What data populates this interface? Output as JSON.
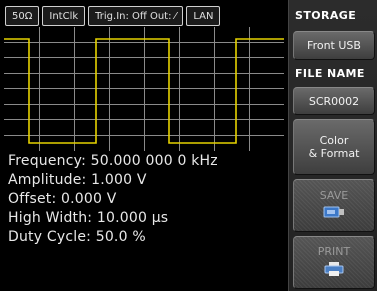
{
  "status_bar": [
    "50Ω",
    "IntClk",
    "Trig.In: Off Out: ⁄",
    "LAN"
  ],
  "readouts": {
    "frequency": "Frequency: 50.000 000 0 kHz",
    "amplitude": "Amplitude: 1.000 V",
    "offset": "Offset: 0.000 V",
    "high_width": "High Width: 10.000 µs",
    "duty_cycle": "Duty Cycle: 50.0 %"
  },
  "sidebar": {
    "storage_header": "STORAGE",
    "storage_button": "Front USB",
    "filename_header": "FILE NAME",
    "filename_button": "SCR0002",
    "color_format_line1": "Color",
    "color_format_line2": "& Format",
    "save_label": "SAVE",
    "print_label": "PRINT"
  },
  "colors": {
    "waveform": "#e6d200",
    "grid": "#8a8a8a",
    "background": "#000000"
  },
  "icons": {
    "save": "usb-stick-icon",
    "print": "printer-icon"
  }
}
